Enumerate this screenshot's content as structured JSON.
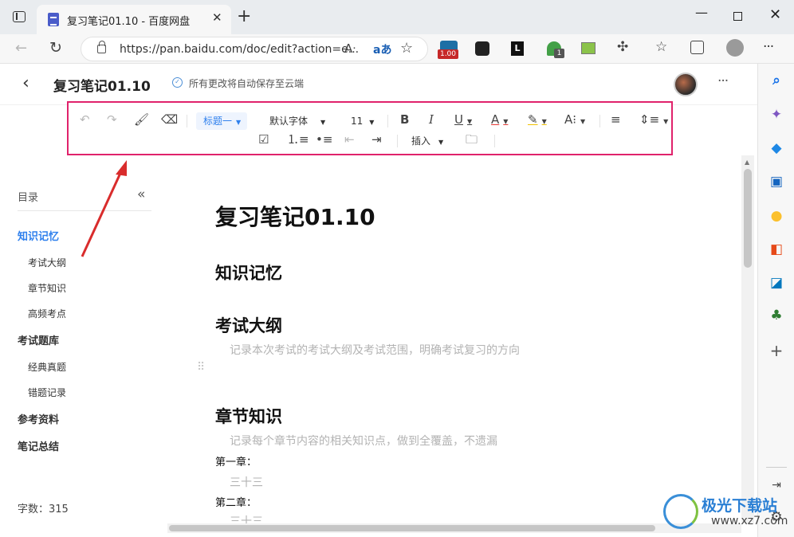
{
  "browser": {
    "tab_title": "复习笔记01.10 - 百度网盘",
    "tab_close": "✕",
    "new_tab": "+",
    "url": "https://pan.baidu.com/doc/edit?action=e...",
    "window_controls": {
      "minimize": "—",
      "close": "✕"
    },
    "extensions": {
      "badge_1": "1.00",
      "badge_4": "1",
      "ext_3_letter": "L"
    },
    "menu_more": "···"
  },
  "doc_header": {
    "title": "复习笔记01.10",
    "save_status": "所有更改将自动保存至云端",
    "more": "···"
  },
  "editor_toolbar": {
    "heading_style": "标题一",
    "font_family": "默认字体",
    "font_size": "11",
    "insert_label": "插入"
  },
  "toc": {
    "title": "目录",
    "items": [
      {
        "label": "知识记忆",
        "level": 1,
        "active": true
      },
      {
        "label": "考试大纲",
        "level": 2
      },
      {
        "label": "章节知识",
        "level": 2
      },
      {
        "label": "高频考点",
        "level": 2
      },
      {
        "label": "考试题库",
        "level": 1
      },
      {
        "label": "经典真题",
        "level": 2
      },
      {
        "label": "错题记录",
        "level": 2
      },
      {
        "label": "参考资料",
        "level": 1
      },
      {
        "label": "笔记总结",
        "level": 1
      }
    ],
    "word_count": "字数：315"
  },
  "document": {
    "title": "复习笔记01.10",
    "section_1": "知识记忆",
    "section_1_1": "考试大纲",
    "section_1_1_placeholder": "记录本次考试的考试大纲及考试范围，明确考试复习的方向",
    "section_1_2": "章节知识",
    "section_1_2_placeholder": "记录每个章节内容的相关知识点，做到全覆盖，不遗漏",
    "chapter_1": "第一章：",
    "chapter_1_placeholder": "三十三",
    "chapter_2": "第二章：",
    "chapter_2_placeholder": "三十三"
  },
  "colors": {
    "toolbar_highlight_border": "#e0226b",
    "accent_blue": "#2f80ed",
    "annotation_arrow": "#d92c2c"
  },
  "watermark": {
    "name": "极光下载站",
    "url": "www.xz7.com"
  }
}
